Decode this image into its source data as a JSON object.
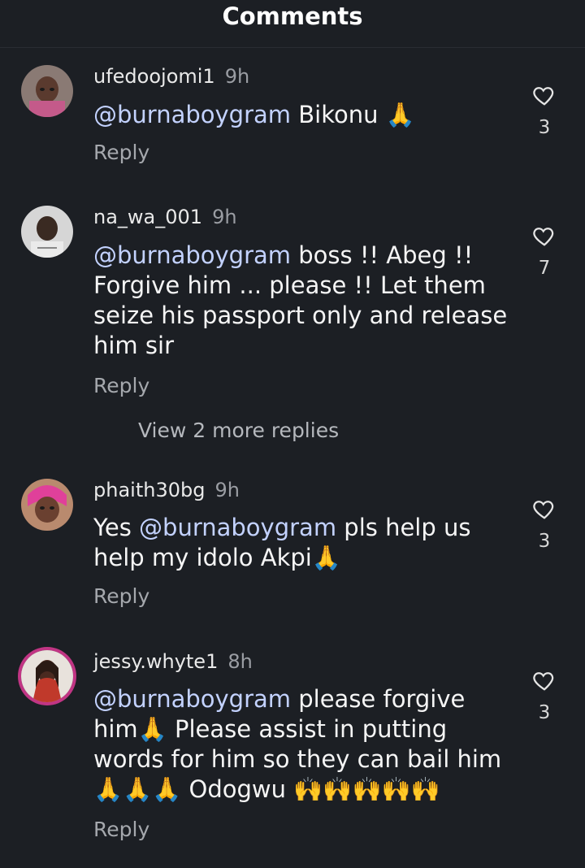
{
  "header": {
    "title": "Comments"
  },
  "comments": [
    {
      "username": "ufedoojomi1",
      "time": "9h",
      "mention": "@burnaboygram",
      "text": " Bikonu 🙏",
      "reply_label": "Reply",
      "likes": "3"
    },
    {
      "username": "na_wa_001",
      "time": "9h",
      "mention": "@burnaboygram",
      "text": " boss !! Abeg !! Forgive him ... please !! Let them seize his passport only and release him sir",
      "reply_label": "Reply",
      "likes": "7",
      "view_more": "View 2 more replies"
    },
    {
      "username": "phaith30bg",
      "time": "9h",
      "prefix": "Yes ",
      "mention": "@burnaboygram",
      "text": "  pls help us help my idolo Akpi🙏",
      "reply_label": "Reply",
      "likes": "3"
    },
    {
      "username": "jessy.whyte1",
      "time": "8h",
      "mention": "@burnaboygram",
      "text": " please forgive him🙏 Please assist in putting words for him so they can bail him 🙏🙏🙏 Odogwu 🙌🙌🙌🙌🙌",
      "reply_label": "Reply",
      "likes": "3"
    }
  ],
  "colors": {
    "background": "#1c1f24",
    "mention": "#c3d2ff",
    "story_ring": "#c13584"
  }
}
